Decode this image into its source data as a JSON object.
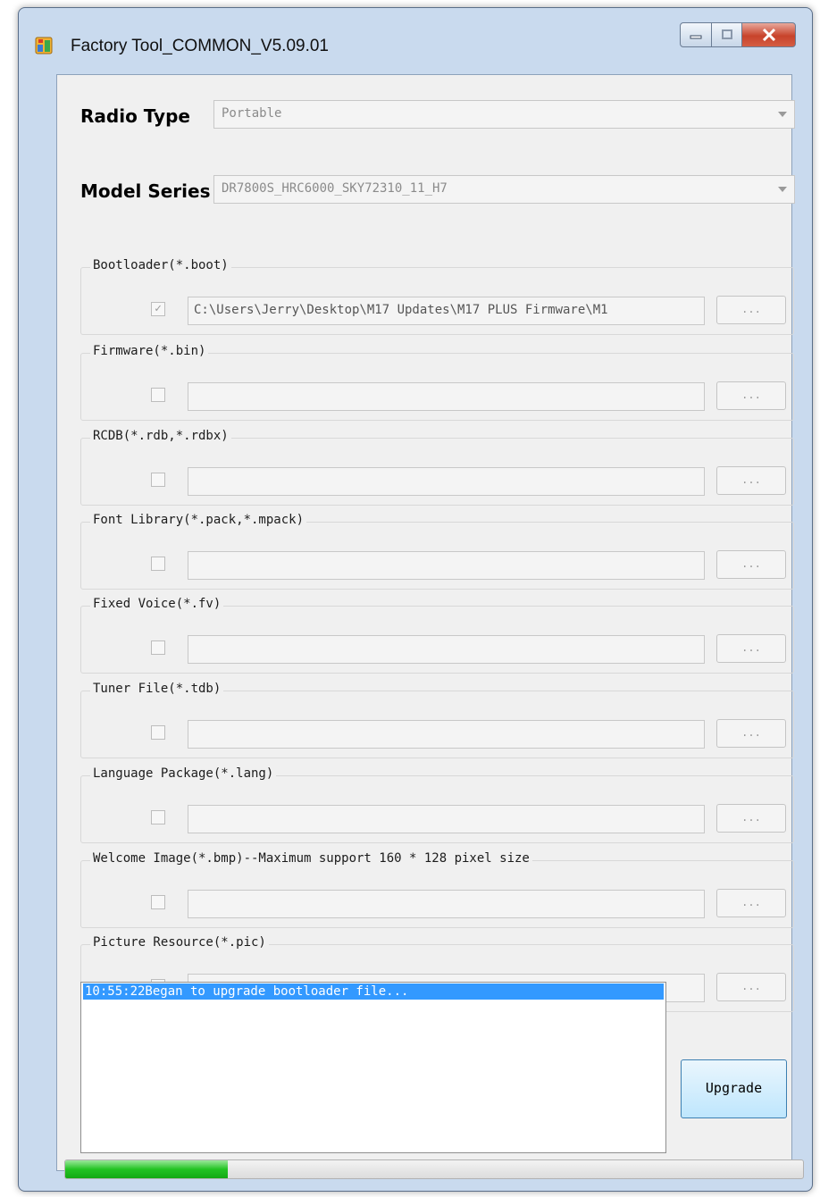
{
  "window": {
    "title": "Factory Tool_COMMON_V5.09.01"
  },
  "radio_type": {
    "label": "Radio Type",
    "value": "Portable"
  },
  "model_series": {
    "label": "Model Series",
    "value": "DR7800S_HRC6000_SKY72310_11_H7"
  },
  "groups": [
    {
      "label": "Bootloader(*.boot)",
      "checked": true,
      "path": "C:\\Users\\Jerry\\Desktop\\M17 Updates\\M17 PLUS Firmware\\M1",
      "browse": "..."
    },
    {
      "label": "Firmware(*.bin)",
      "checked": false,
      "path": "",
      "browse": "..."
    },
    {
      "label": "RCDB(*.rdb,*.rdbx)",
      "checked": false,
      "path": "",
      "browse": "..."
    },
    {
      "label": "Font Library(*.pack,*.mpack)",
      "checked": false,
      "path": "",
      "browse": "..."
    },
    {
      "label": "Fixed Voice(*.fv)",
      "checked": false,
      "path": "",
      "browse": "..."
    },
    {
      "label": "Tuner File(*.tdb)",
      "checked": false,
      "path": "",
      "browse": "..."
    },
    {
      "label": "Language Package(*.lang)",
      "checked": false,
      "path": "",
      "browse": "..."
    },
    {
      "label": "Welcome Image(*.bmp)--Maximum support 160 * 128 pixel size",
      "checked": false,
      "path": "",
      "browse": "..."
    },
    {
      "label": "Picture Resource(*.pic)",
      "checked": false,
      "path": "",
      "browse": "..."
    }
  ],
  "log": {
    "lines": [
      "10:55:22Began to upgrade bootloader file..."
    ]
  },
  "upgrade_button": {
    "label": "Upgrade"
  },
  "progress": {
    "fraction": 0.22
  },
  "colors": {
    "selection": "#3399ff",
    "progress": "#23c323",
    "close_button": "#c8432b"
  }
}
